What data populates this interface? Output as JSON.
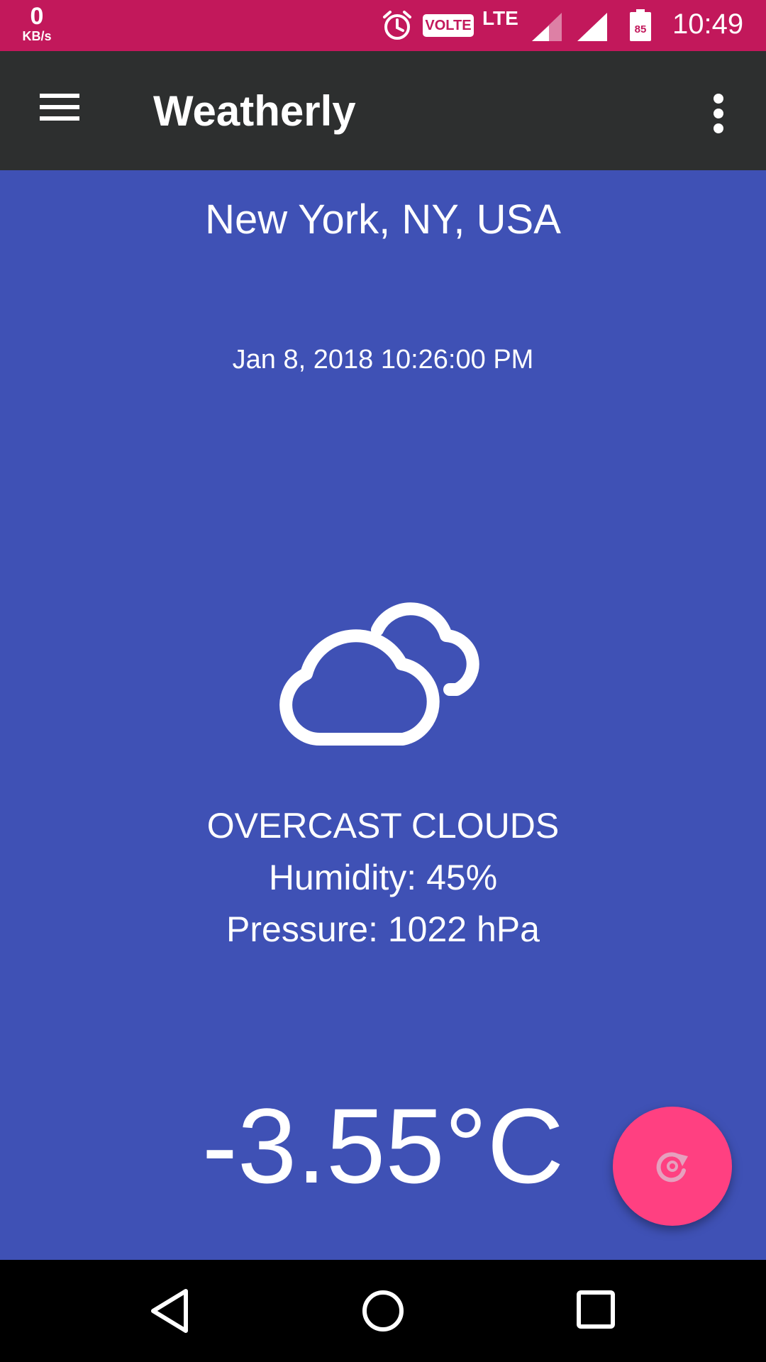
{
  "status_bar": {
    "net_speed_value": "0",
    "net_speed_unit": "KB/s",
    "volte_label": "VOLTE",
    "network_type": "LTE",
    "battery_level": "85",
    "time": "10:49",
    "icons": [
      "alarm-icon",
      "volte-icon",
      "signal-icon",
      "battery-icon"
    ],
    "background_color": "#C2185B"
  },
  "app_bar": {
    "title": "Weatherly",
    "menu_icon": "hamburger-menu-icon",
    "overflow_icon": "more-vert-icon",
    "background_color": "#2D2F2F"
  },
  "weather": {
    "location": "New York, NY, USA",
    "datetime": "Jan 8, 2018 10:26:00 PM",
    "icon": "overcast-clouds-icon",
    "condition": "OVERCAST CLOUDS",
    "humidity": "Humidity: 45%",
    "pressure": "Pressure: 1022 hPa",
    "temperature": "-3.55°C",
    "background_color": "#3F51B5"
  },
  "fab": {
    "icon": "refresh-icon",
    "color": "#FF4081"
  },
  "nav_bar": {
    "icons": [
      "back-icon",
      "home-icon",
      "recents-icon"
    ]
  }
}
